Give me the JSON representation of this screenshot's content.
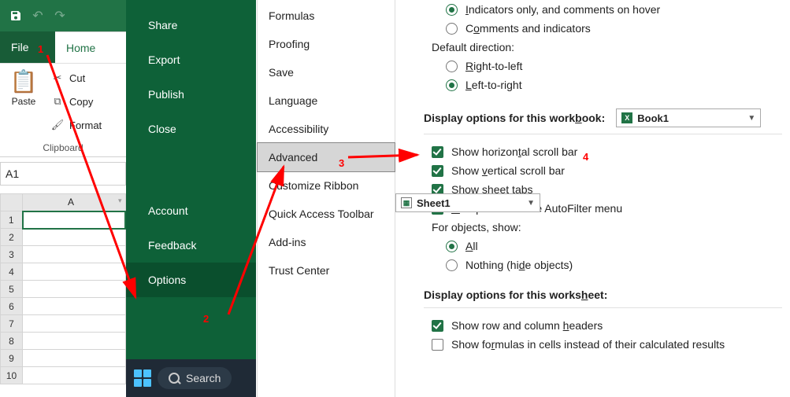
{
  "qat": {},
  "tabs": {
    "file": "File",
    "home": "Home"
  },
  "ribbon": {
    "paste": "Paste",
    "cut": "Cut",
    "copy": "Copy",
    "format": "Format",
    "group": "Clipboard"
  },
  "namebox": "A1",
  "sheet": {
    "colA": "A",
    "rows": [
      "1",
      "2",
      "3",
      "4",
      "5",
      "6",
      "7",
      "8",
      "9",
      "10"
    ]
  },
  "backstage": {
    "share": "Share",
    "export": "Export",
    "publish": "Publish",
    "close": "Close",
    "account": "Account",
    "feedback": "Feedback",
    "options": "Options"
  },
  "categories": {
    "formulas": "Formulas",
    "proofing": "Proofing",
    "save": "Save",
    "language": "Language",
    "accessibility": "Accessibility",
    "advanced": "Advanced",
    "customize_ribbon": "Customize Ribbon",
    "qat": "Quick Access Toolbar",
    "addins": "Add-ins",
    "trust": "Trust Center"
  },
  "options": {
    "indicators_only": "Indicators only, and comments on hover",
    "comments_and_indicators": "Comments and indicators",
    "default_direction": "Default direction:",
    "rtl": "Right-to-left",
    "ltr": "Left-to-right",
    "wb_section": "Display options for this workbook:",
    "wb_name": "Book1",
    "h_scroll": "Show horizontal scroll bar",
    "v_scroll": "Show vertical scroll bar",
    "sheet_tabs": "Show sheet tabs",
    "group_dates": "Group dates in the AutoFilter menu",
    "objects_label": "For objects, show:",
    "obj_all": "All",
    "obj_nothing": "Nothing (hide objects)",
    "ws_section": "Display options for this worksheet:",
    "ws_name": "Sheet1",
    "row_col_headers": "Show row and column headers",
    "show_formulas": "Show formulas in cells instead of their calculated results"
  },
  "taskbar": {
    "search": "Search"
  },
  "annotations": {
    "n1": "1",
    "n2": "2",
    "n3": "3",
    "n4": "4"
  }
}
